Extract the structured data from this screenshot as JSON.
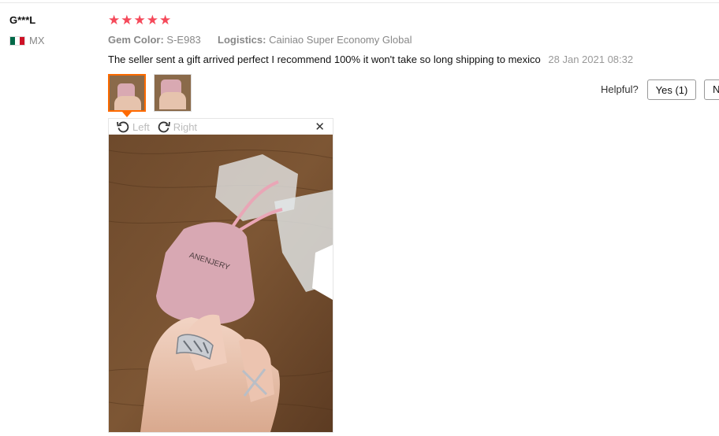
{
  "reviewer": {
    "name": "G***L",
    "country_code": "MX",
    "flag_colors": [
      "#006847",
      "#ffffff",
      "#ce1126"
    ]
  },
  "rating": {
    "stars": 5,
    "max": 5,
    "color": "#f5495a"
  },
  "attributes": {
    "gem_color_label": "Gem Color:",
    "gem_color_value": "S-E983",
    "logistics_label": "Logistics:",
    "logistics_value": "Cainiao Super Economy Global"
  },
  "review": {
    "text": "The seller sent a gift arrived perfect I recommend 100% it won't take so long shipping to mexico",
    "date": "28 Jan 2021 08:32"
  },
  "helpful": {
    "label": "Helpful?",
    "yes_label": "Yes (1)",
    "no_label": "N"
  },
  "viewer": {
    "rotate_left_label": "Left",
    "rotate_right_label": "Right",
    "close_icon": "close-icon",
    "pouch_brand_text": "ANENJERY"
  },
  "colors": {
    "accent": "#ff6a00"
  }
}
